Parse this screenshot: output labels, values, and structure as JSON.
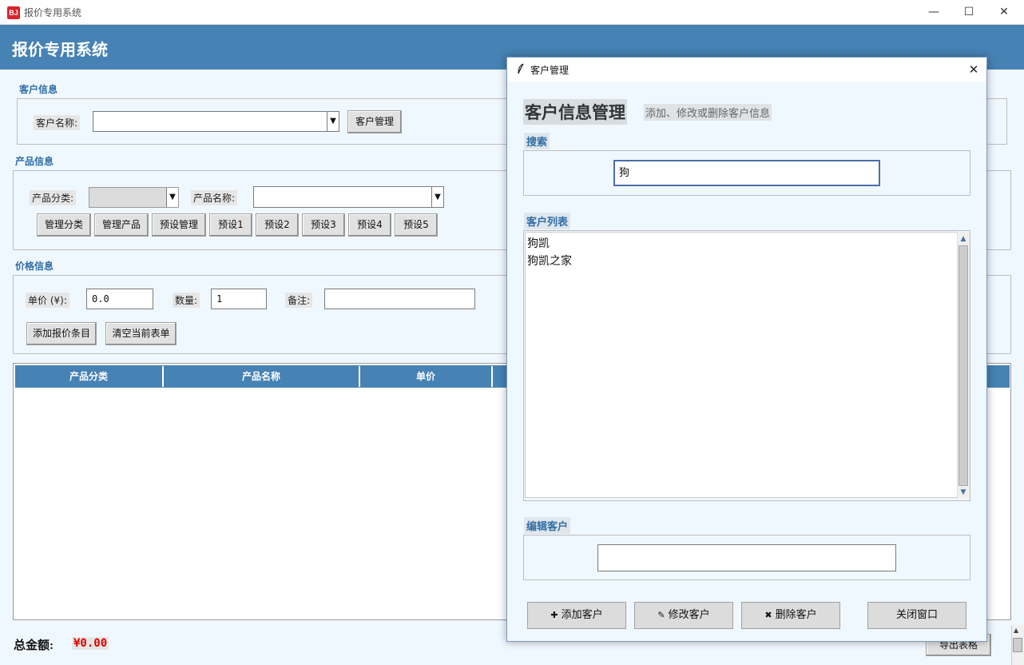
{
  "window": {
    "title": "报价专用系统",
    "app_icon_text": "BJ",
    "minimize_glyph": "—",
    "maximize_glyph": "☐",
    "close_glyph": "✕"
  },
  "header": {
    "title": "报价专用系统"
  },
  "customer_section": {
    "label": "客户信息",
    "name_label": "客户名称:",
    "name_value": "",
    "manage_button": "客户管理"
  },
  "product_section": {
    "label": "产品信息",
    "category_label": "产品分类:",
    "category_value": "",
    "name_label": "产品名称:",
    "name_value": "",
    "buttons": [
      "管理分类",
      "管理产品",
      "预设管理",
      "预设1",
      "预设2",
      "预设3",
      "预设4",
      "预设5"
    ]
  },
  "price_section": {
    "label": "价格信息",
    "unit_price_label": "单价 (¥):",
    "unit_price_value": "0.0",
    "quantity_label": "数量:",
    "quantity_value": "1",
    "note_label": "备注:",
    "note_value": "",
    "add_item_button": "添加报价条目",
    "clear_button": "清空当前表单"
  },
  "table": {
    "columns": [
      "产品分类",
      "产品名称",
      "单价"
    ],
    "rows": []
  },
  "footer": {
    "total_label": "总金额:",
    "total_value": "¥0.00",
    "export_button": "导出表格"
  },
  "dialog": {
    "title": "客户管理",
    "close_glyph": "✕",
    "heading": "客户信息管理",
    "subheading": "添加、修改或删除客户信息",
    "search_label": "搜索",
    "search_value": "狗",
    "list_label": "客户列表",
    "customers": [
      "狗凯",
      "狗凯之家"
    ],
    "edit_label": "编辑客户",
    "edit_value": "",
    "add_button": "添加客户",
    "add_glyph": "✚",
    "edit_button": "修改客户",
    "edit_glyph": "✎",
    "delete_button": "删除客户",
    "delete_glyph": "✖",
    "close_button": "关闭窗口"
  },
  "colors": {
    "accent": "#4682b4",
    "background": "#f0f8ff",
    "section_label": "#2f6ea5",
    "total_value": "#e00000"
  }
}
